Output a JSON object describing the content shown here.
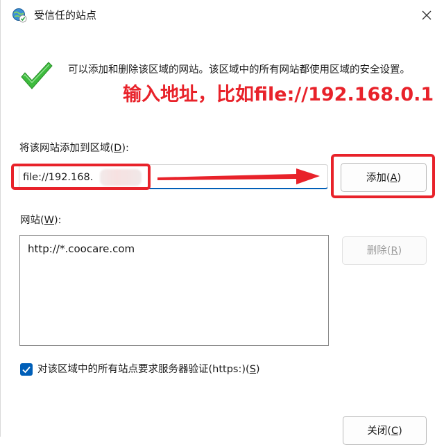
{
  "window": {
    "title": "受信任的站点",
    "icon": "globe-check-icon",
    "close_icon": "close-icon"
  },
  "info": {
    "text": "可以添加和删除该区域的网站。该区域中的所有网站都使用区域的安全设置。",
    "icon": "green-check-icon"
  },
  "annotation": {
    "text": "输入地址，比如file://192.168.0.1",
    "color": "#e8222a"
  },
  "add_section": {
    "label_prefix": "将该网站添加到区域(",
    "label_key": "D",
    "label_suffix": "):",
    "input_value": "file://192.168.",
    "add_button_prefix": "添加(",
    "add_button_key": "A",
    "add_button_suffix": ")"
  },
  "sites_section": {
    "label_prefix": "网站(",
    "label_key": "W",
    "label_suffix": "):",
    "items": [
      "http://*.coocare.com"
    ],
    "remove_button_prefix": "删除(",
    "remove_button_key": "R",
    "remove_button_suffix": ")"
  },
  "https_checkbox": {
    "checked": true,
    "label_prefix": "对该区域中的所有站点要求服务器验证(https:)(",
    "label_key": "S",
    "label_suffix": ")"
  },
  "footer": {
    "close_button_prefix": "关闭(",
    "close_button_key": "C",
    "close_button_suffix": ")"
  },
  "colors": {
    "accent": "#005fb8",
    "highlight_red": "#e8222a",
    "check_green": "#2ea043"
  }
}
